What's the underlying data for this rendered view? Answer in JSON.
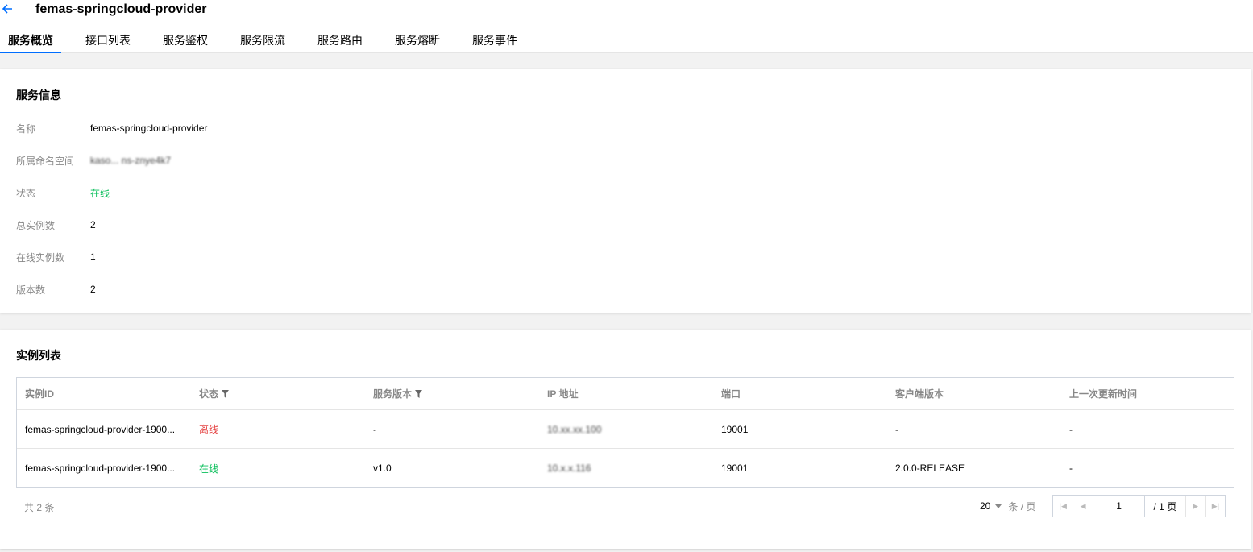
{
  "header": {
    "title": "femas-springcloud-provider",
    "tabs": [
      "服务概览",
      "接口列表",
      "服务鉴权",
      "服务限流",
      "服务路由",
      "服务熔断",
      "服务事件"
    ]
  },
  "service_info": {
    "section_title": "服务信息",
    "name_label": "名称",
    "name_value": "femas-springcloud-provider",
    "namespace_label": "所属命名空间",
    "namespace_value": "kaso... ns-znye4k7",
    "status_label": "状态",
    "status_value": "在线",
    "total_instances_label": "总实例数",
    "total_instances_value": "2",
    "online_instances_label": "在线实例数",
    "online_instances_value": "1",
    "version_count_label": "版本数",
    "version_count_value": "2"
  },
  "instance_list": {
    "section_title": "实例列表",
    "columns": [
      "实例ID",
      "状态",
      "服务版本",
      "IP 地址",
      "端口",
      "客户端版本",
      "上一次更新时间"
    ],
    "rows": [
      {
        "id": "femas-springcloud-provider-1900...",
        "status": "离线",
        "version": "-",
        "ip": "10.xx.xx.100",
        "port": "19001",
        "client_version": "-",
        "updated": "-"
      },
      {
        "id": "femas-springcloud-provider-1900...",
        "status": "在线",
        "version": "v1.0",
        "ip": "10.x.x.116",
        "port": "19001",
        "client_version": "2.0.0-RELEASE",
        "updated": "-"
      }
    ],
    "total_text": "共 2 条",
    "page_size": "20",
    "per_page_text": "条 / 页",
    "current_page": "1",
    "total_pages_text": "/ 1 页"
  },
  "colors": {
    "accent": "#006eff",
    "online": "#0abf5b",
    "offline": "#e54545"
  }
}
